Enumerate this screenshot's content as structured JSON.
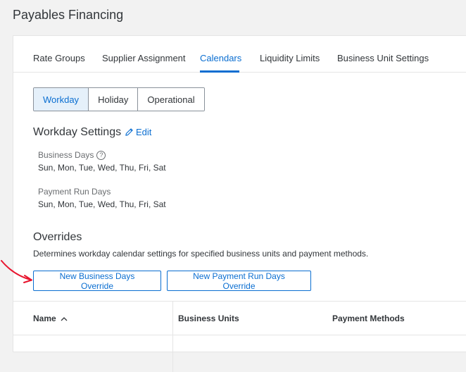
{
  "page": {
    "title": "Payables Financing"
  },
  "tabs": [
    {
      "label": "Rate Groups"
    },
    {
      "label": "Supplier Assignment"
    },
    {
      "label": "Calendars"
    },
    {
      "label": "Liquidity Limits"
    },
    {
      "label": "Business Unit Settings"
    }
  ],
  "active_tab": "Calendars",
  "calendar_types": [
    {
      "label": "Workday"
    },
    {
      "label": "Holiday"
    },
    {
      "label": "Operational"
    }
  ],
  "active_calendar_type": "Workday",
  "workday_settings": {
    "title": "Workday Settings",
    "edit_label": "Edit",
    "business_days_label": "Business Days",
    "business_days_value": "Sun, Mon, Tue, Wed, Thu, Fri, Sat",
    "payment_run_days_label": "Payment Run Days",
    "payment_run_days_value": "Sun, Mon, Tue, Wed, Thu, Fri, Sat"
  },
  "overrides": {
    "title": "Overrides",
    "description": "Determines workday calendar settings for specified business units and payment methods.",
    "new_business_days_button": "New Business Days Override",
    "new_payment_run_days_button": "New Payment Run Days Override"
  },
  "table": {
    "columns": [
      {
        "label": "Name",
        "sort": "ascending"
      },
      {
        "label": "Business Units"
      },
      {
        "label": "Payment Methods"
      }
    ]
  },
  "colors": {
    "accent": "#0a6ed1",
    "annotation_arrow": "#e8152e"
  },
  "icons": {
    "edit": "pencil-icon",
    "help": "question-circle-icon",
    "sort": "chevron-up-icon"
  }
}
